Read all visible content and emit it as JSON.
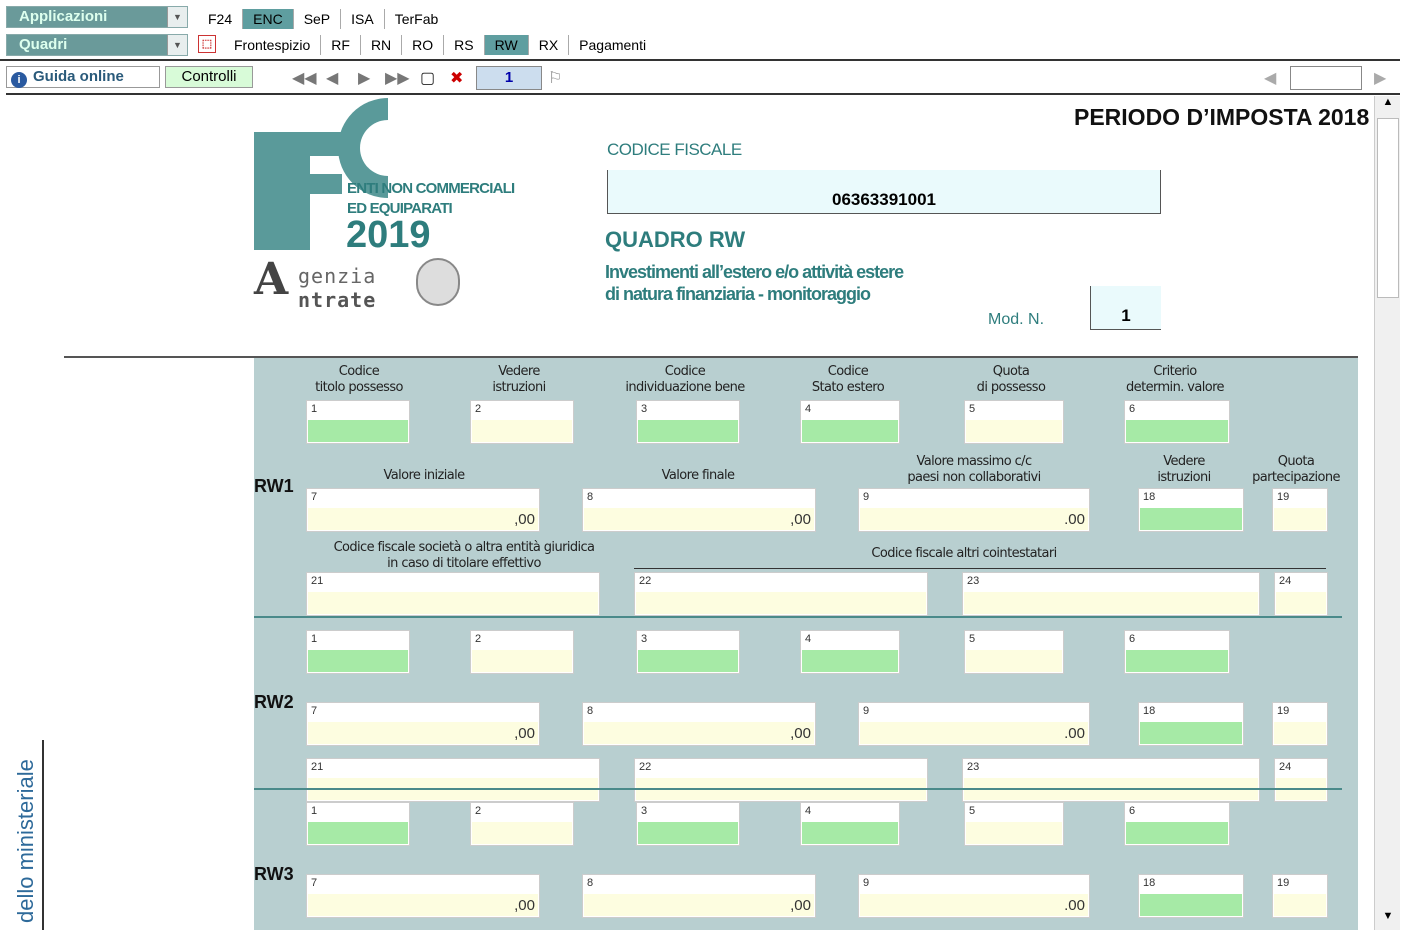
{
  "toolbar": {
    "applicazioni": "Applicazioni",
    "quadri": "Quadri",
    "app_tabs": [
      "F24",
      "ENC",
      "SeP",
      "ISA",
      "TerFab"
    ],
    "quadri_tabs": [
      "Frontespizio",
      "RF",
      "RN",
      "RO",
      "RS",
      "RW",
      "RX",
      "Pagamenti"
    ],
    "guida": "Guida online",
    "controlli": "Controlli",
    "page_number": "1",
    "search_value": ""
  },
  "header": {
    "periodo": "PERIODO D’IMPOSTA 2018",
    "codice_fiscale_label": "CODICE FISCALE",
    "codice_fiscale": "06363391001",
    "quadro_title": "QUADRO RW",
    "quadro_sub1": "Investimenti all’estero e/o attività estere",
    "quadro_sub2": "di natura finanziaria - monitoraggio",
    "mod_label": "Mod. N.",
    "mod_value": "1"
  },
  "logo": {
    "enti1": "ENTI NON COMMERCIALI",
    "enti2": "ED EQUIPARATI",
    "year": "2019",
    "agenzia1": "genzia",
    "agenzia2": "ntrate"
  },
  "side_text": "dello ministeriale",
  "columns": {
    "c1": [
      "Codice",
      "titolo possesso"
    ],
    "c2": [
      "Vedere",
      "istruzioni"
    ],
    "c3": [
      "Codice",
      "individuazione bene"
    ],
    "c4": [
      "Codice",
      "Stato estero"
    ],
    "c5": [
      "Quota",
      "di possesso"
    ],
    "c6": [
      "Criterio",
      "determin. valore"
    ],
    "valore_iniziale": "Valore iniziale",
    "valore_finale": "Valore finale",
    "valore_massimo": [
      "Valore massimo c/c",
      "paesi non collaborativi"
    ],
    "vedere_istr": [
      "Vedere",
      "istruzioni"
    ],
    "quota_part": [
      "Quota",
      "partecipazione"
    ],
    "cf_societa": [
      "Codice fiscale società o altra entità giuridica",
      "in caso di titolare effettivo"
    ],
    "cf_altri": "Codice fiscale altri cointestatari"
  },
  "rows": [
    "RW1",
    "RW2",
    "RW3"
  ],
  "fields": {
    "n1": "1",
    "n2": "2",
    "n3": "3",
    "n4": "4",
    "n5": "5",
    "n6": "6",
    "n7": "7",
    "n8": "8",
    "n9": "9",
    "n18": "18",
    "n19": "19",
    "n21": "21",
    "n22": "22",
    "n23": "23",
    "n24": "24",
    "cents": ",00",
    "cents9": ".00"
  },
  "colors": {
    "accent": "#5f9ea0",
    "form_bg": "#b8cfd0",
    "green_field": "#a6eaa6",
    "yellow_field": "#fdfde0",
    "title": "#2e7d7d"
  }
}
